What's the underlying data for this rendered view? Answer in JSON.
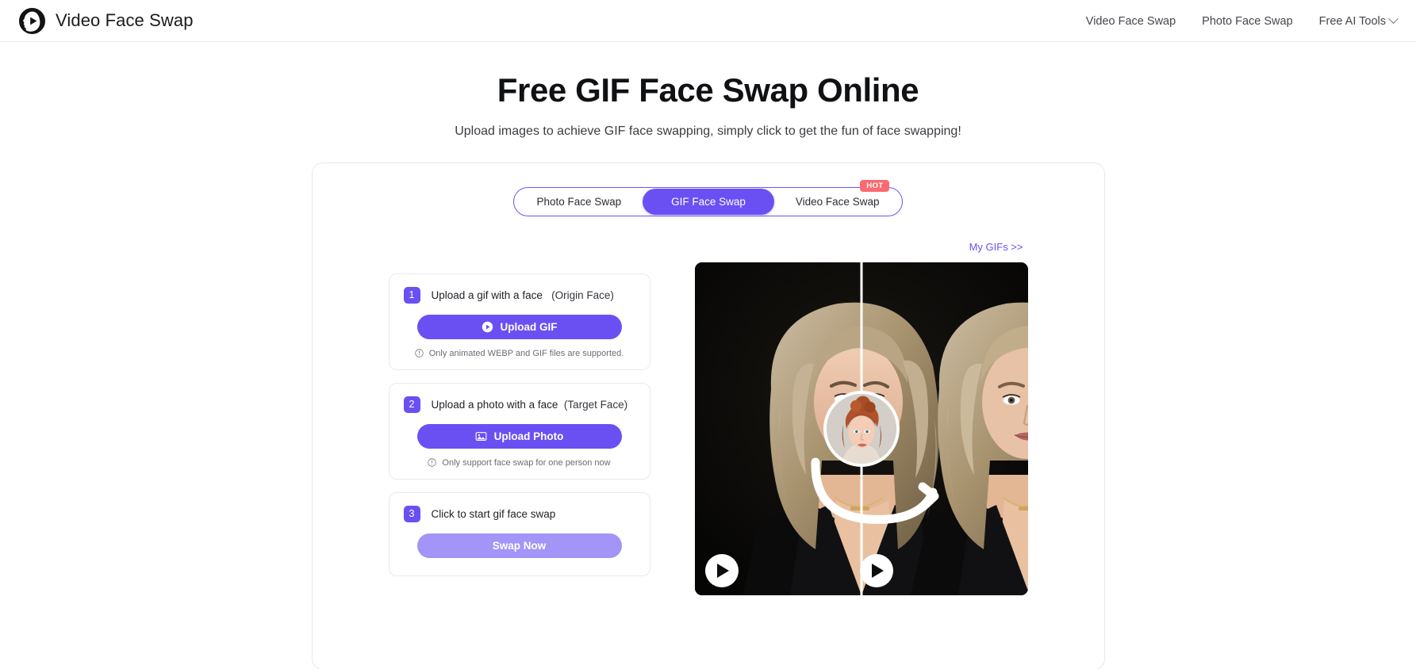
{
  "header": {
    "logo_icon": "face-play-logo-icon",
    "brand_name": "Video Face Swap",
    "nav": [
      {
        "label": "Video Face Swap",
        "has_caret": false
      },
      {
        "label": "Photo Face Swap",
        "has_caret": false
      },
      {
        "label": "Free AI Tools",
        "has_caret": true
      }
    ]
  },
  "hero": {
    "title": "Free GIF Face Swap Online",
    "subtitle": "Upload images to achieve GIF face swapping, simply click to get the fun of face swapping!"
  },
  "tabs": {
    "items": [
      {
        "label": "Photo Face Swap",
        "active": false,
        "badge": ""
      },
      {
        "label": "GIF Face Swap",
        "active": true,
        "badge": ""
      },
      {
        "label": "Video Face Swap",
        "active": false,
        "badge": "HOT"
      }
    ],
    "badge_label": "HOT"
  },
  "steps": [
    {
      "number": "1",
      "title": "Upload a gif with a face",
      "subtitle": "(Origin Face)",
      "button_label": "Upload GIF",
      "button_icon": "play-circle-icon",
      "button_state": "enabled",
      "hint": "Only animated WEBP and GIF files are supported.",
      "hint_icon": "info-circle-icon"
    },
    {
      "number": "2",
      "title": "Upload a photo with a face",
      "subtitle": "(Target Face)",
      "button_label": "Upload Photo",
      "button_icon": "image-icon",
      "button_state": "enabled",
      "hint": "Only support face swap for one person now",
      "hint_icon": "info-circle-icon"
    },
    {
      "number": "3",
      "title": "Click to start gif face swap",
      "subtitle": "",
      "button_label": "Swap Now",
      "button_icon": "",
      "button_state": "disabled",
      "hint": "",
      "hint_icon": ""
    }
  ],
  "preview": {
    "my_gifs_label": "My GIFs >>",
    "left_play_icon": "play-icon",
    "right_play_icon": "play-icon",
    "avatar_icon": "target-face-thumbnail",
    "arrow_icon": "curved-arrow-icon",
    "alt_left": "Blonde woman before face swap",
    "alt_right": "Blonde woman after face swap"
  },
  "colors": {
    "accent": "#6a50f3",
    "accent_muted": "#a394f7",
    "badge_red": "#fa6a70",
    "text_primary": "#1f2026",
    "text_muted": "#6b6d75",
    "border": "#e9eaee",
    "page_bg": "#ffffff"
  }
}
